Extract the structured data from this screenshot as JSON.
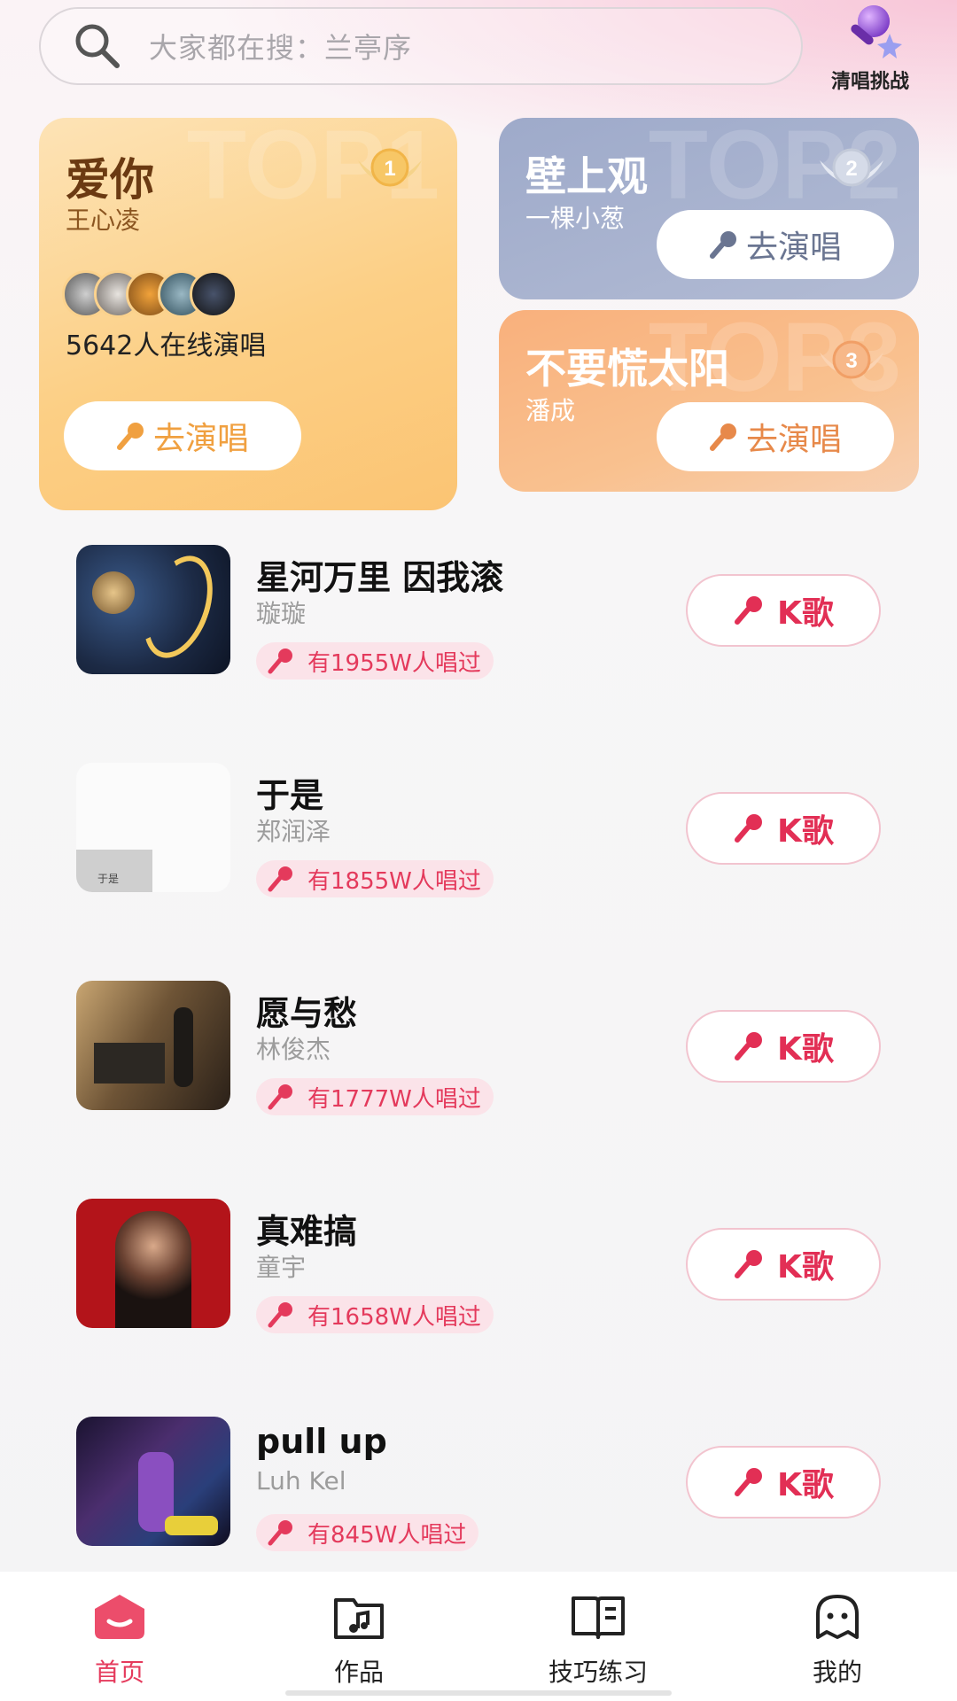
{
  "search": {
    "placeholder": "大家都在搜：兰亭序",
    "icon": "search-icon"
  },
  "challenge": {
    "label": "清唱挑战",
    "icon": "microphone-icon"
  },
  "top_cards": [
    {
      "rank": 1,
      "title": "爱你",
      "artist": "王心凌",
      "online": "5642人在线演唱",
      "button": "去演唱",
      "watermark": "TOP1"
    },
    {
      "rank": 2,
      "title": "壁上观",
      "artist": "一棵小葱",
      "button": "去演唱",
      "watermark": "TOP2"
    },
    {
      "rank": 3,
      "title": "不要慌太阳",
      "artist": "潘成",
      "button": "去演唱",
      "watermark": "TOP3"
    }
  ],
  "songs": [
    {
      "title": "星河万里 因我滚",
      "artist": "璇璇",
      "count": "有1955W人唱过",
      "button": "K歌"
    },
    {
      "title": "于是",
      "artist": "郑润泽",
      "count": "有1855W人唱过",
      "button": "K歌",
      "cover_caption": "于是"
    },
    {
      "title": "愿与愁",
      "artist": "林俊杰",
      "count": "有1777W人唱过",
      "button": "K歌"
    },
    {
      "title": "真难搞",
      "artist": "童宇",
      "count": "有1658W人唱过",
      "button": "K歌"
    },
    {
      "title": "pull up",
      "artist": "Luh Kel",
      "count": "有845W人唱过",
      "button": "K歌"
    }
  ],
  "tabs": [
    {
      "label": "首页",
      "icon": "home-icon",
      "active": true
    },
    {
      "label": "作品",
      "icon": "music-folder-icon",
      "active": false
    },
    {
      "label": "技巧练习",
      "icon": "book-icon",
      "active": false
    },
    {
      "label": "我的",
      "icon": "ghost-profile-icon",
      "active": false
    }
  ],
  "colors": {
    "accent": "#e53a5c",
    "gold": "#fbc473",
    "slate": "#9eaaca",
    "orange": "#f9b07c"
  }
}
